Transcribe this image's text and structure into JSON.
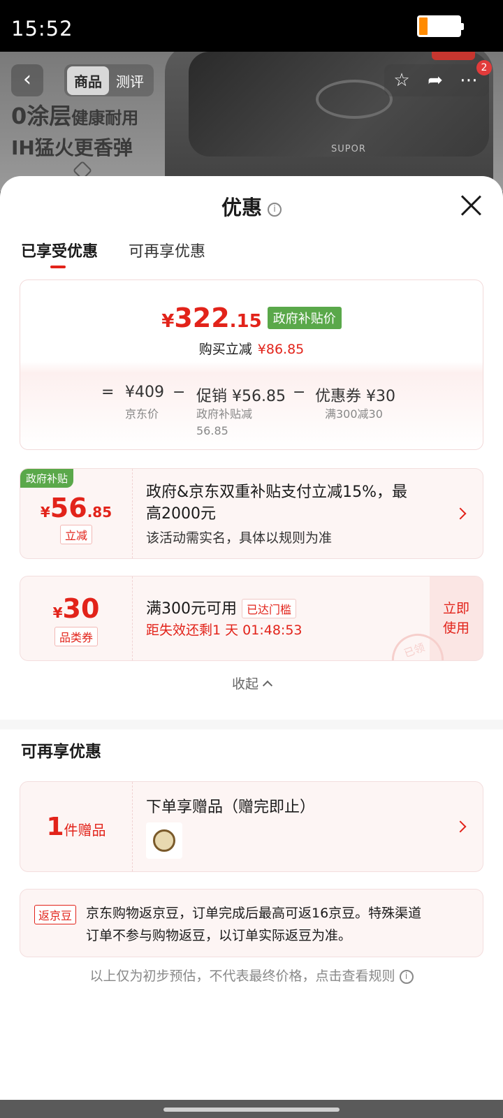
{
  "status_bar": {
    "time": "15:52"
  },
  "product_header": {
    "tabs": [
      "商品",
      "测评"
    ],
    "promo_line1_big": "0涂层",
    "promo_line1_small": "健康耐用",
    "promo_line2": "IH猛火更香弹",
    "brand": "SUPOR",
    "cart_count": "2"
  },
  "sheet": {
    "title": "优惠",
    "tabs": {
      "active": "已享受优惠",
      "inactive": "可再享优惠"
    }
  },
  "summary": {
    "price_yen": "¥",
    "price_int": "322",
    "price_dec": ".15",
    "price_tag": "政府补贴价",
    "save_label": "购买立减",
    "save_value": "¥86.85",
    "formula": {
      "eq": "=",
      "base": "¥409",
      "minus1": "−",
      "promo": "促销 ¥56.85",
      "minus2": "−",
      "coupon": "优惠券 ¥30"
    },
    "base_sub": "京东价",
    "promo_sub_line1": "政府补贴减",
    "promo_sub_line2": "56.85",
    "coupon_sub": "满300减30"
  },
  "gov_card": {
    "corner_tag": "政府补贴",
    "yen": "¥",
    "amount_int": "56",
    "amount_dec": ".85",
    "chip": "立减",
    "title_line1": "政府&京东双重补贴支付立减15%，最",
    "title_line2": "高2000元",
    "desc": "该活动需实名，具体以规则为准"
  },
  "coupon_card": {
    "yen": "¥",
    "amount": "30",
    "chip": "品类券",
    "condition": "满300元可用",
    "status_chip": "已达门槛",
    "countdown": "距失效还剩1 天 01:48:53",
    "action": [
      "立即",
      "使用"
    ],
    "stamp": "已领"
  },
  "collapse_label": "收起",
  "more_section": {
    "title": "可再享优惠",
    "gift": {
      "count": "1",
      "unit": "件赠品",
      "title": "下单享赠品（赠完即止）"
    },
    "jd_bean": {
      "tag": "返京豆",
      "line1": "京东购物返京豆，订单完成后最高可返16京豆。特殊渠道",
      "line2": "订单不参与购物返豆，以订单实际返豆为准。"
    }
  },
  "footnote": "以上仅为初步预估，不代表最终价格，点击查看规则",
  "colors": {
    "accent": "#e2231a",
    "gov_green": "#5aa84a",
    "card_bg": "#fdf5f4"
  }
}
